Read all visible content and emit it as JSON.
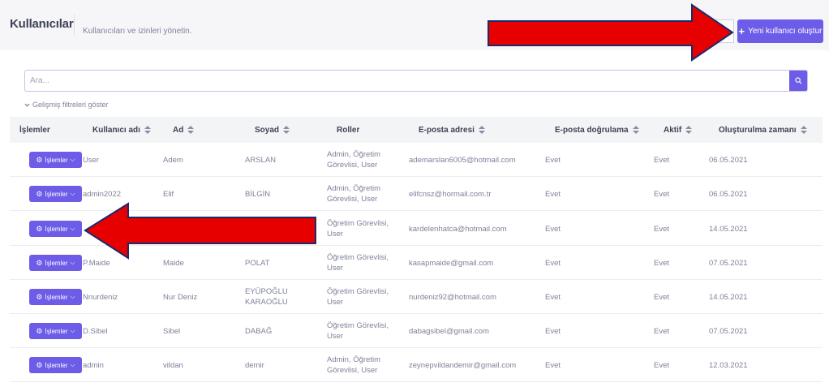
{
  "header": {
    "title": "Kullanıcılar",
    "description": "Kullanıcıları ve izinleri yönetin.",
    "new_user_label": "Yeni kullanıcı oluştur"
  },
  "search": {
    "placeholder": "Ara...",
    "value": ""
  },
  "filters": {
    "toggle_label": "Gelişmiş filtreleri göster"
  },
  "table": {
    "columns": {
      "actions": "İşlemler",
      "username": "Kullanıcı adı",
      "name": "Ad",
      "surname": "Soyad",
      "roles": "Roller",
      "email": "E-posta adresi",
      "email_confirmed": "E-posta doğrulama",
      "active": "Aktif",
      "created": "Oluşturulma zamanı"
    },
    "action_label": "İşlemler",
    "rows": [
      {
        "username": "User",
        "name": "Adem",
        "surname": "ARSLAN",
        "roles": "Admin, Öğretim Görevlisi, User",
        "email": "ademarslan6005@hotmail.com",
        "email_confirmed": "Evet",
        "active": "Evet",
        "created": "06.05.2021"
      },
      {
        "username": "admin2022",
        "name": "Elif",
        "surname": "BİLGİN",
        "roles": "Admin, Öğretim Görevlisi, User",
        "email": "elifcnsz@hormail.com.tr",
        "email_confirmed": "Evet",
        "active": "Evet",
        "created": "06.05.2021"
      },
      {
        "username": "",
        "name": "",
        "surname": "",
        "roles": "Öğretim Görevlisi, User",
        "email": "kardelenhatca@hotmail.com",
        "email_confirmed": "Evet",
        "active": "Evet",
        "created": "14.05.2021"
      },
      {
        "username": "P.Maide",
        "name": "Maide",
        "surname": "POLAT",
        "roles": "Öğretim Görevlisi, User",
        "email": "kasapmaide@gmail.com",
        "email_confirmed": "Evet",
        "active": "Evet",
        "created": "07.05.2021"
      },
      {
        "username": "Nnurdeniz",
        "name": "Nur Deniz",
        "surname": "EYÜPOĞLU KARAOĞLU",
        "roles": "Öğretim Görevlisi, User",
        "email": "nurdeniz92@hotmail.com",
        "email_confirmed": "Evet",
        "active": "Evet",
        "created": "14.05.2021"
      },
      {
        "username": "D.Sibel",
        "name": "Sibel",
        "surname": "DABAĞ",
        "roles": "Öğretim Görevlisi, User",
        "email": "dabagsibel@gmail.com",
        "email_confirmed": "Evet",
        "active": "Evet",
        "created": "07.05.2021"
      },
      {
        "username": "admin",
        "name": "vildan",
        "surname": "demir",
        "roles": "Admin, Öğretim Görevlisi, User",
        "email": "zeynepvildandemir@gmail.com",
        "email_confirmed": "Evet",
        "active": "Evet",
        "created": "12.03.2021"
      }
    ]
  },
  "colors": {
    "accent": "#6c5ce7",
    "annotation_arrow": "#e60000"
  },
  "icons": {
    "search": "search-icon",
    "plus": "plus-icon",
    "gear": "gear-icon",
    "chevron": "chevron-down-icon",
    "sort": "sort-icon"
  }
}
